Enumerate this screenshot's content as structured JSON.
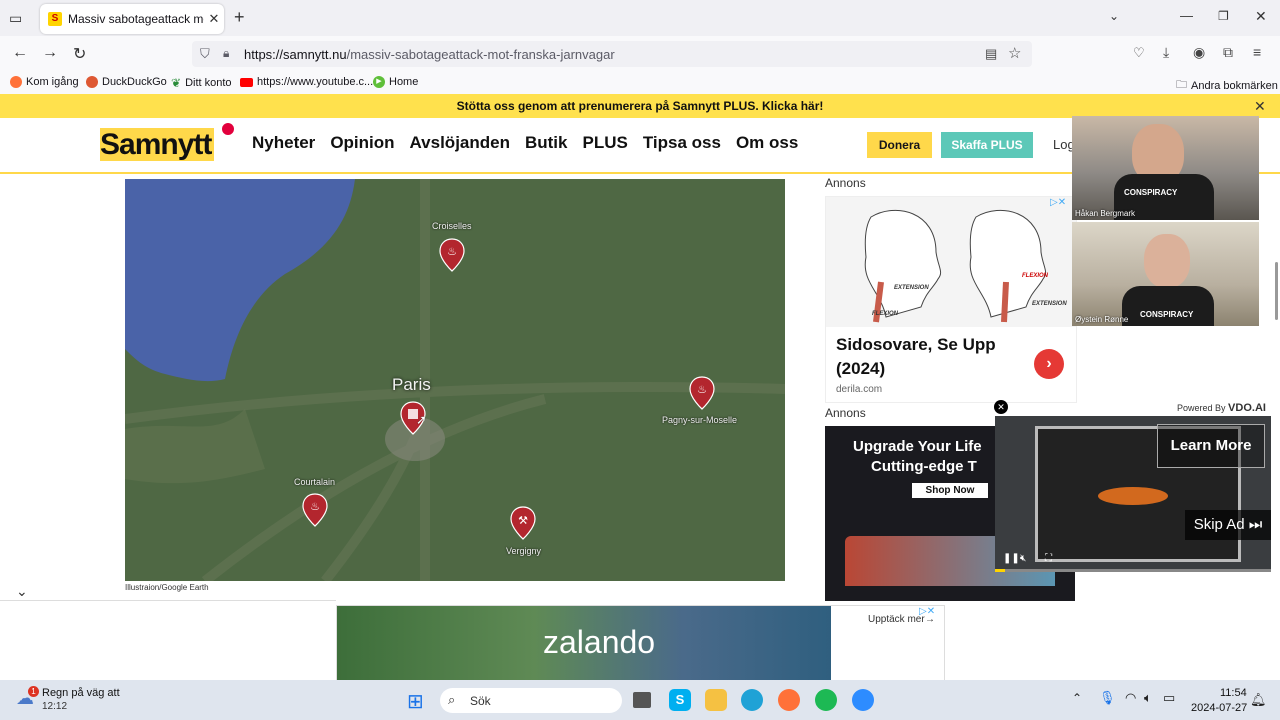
{
  "browser": {
    "tab_title": "Massiv sabotageattack mot fra",
    "url": "https://samnytt.nu/massiv-sabotageattack-mot-franska-jarnvagar",
    "url_host": "https://samnytt.nu",
    "url_path": "/massiv-sabotageattack-mot-franska-jarnvagar",
    "bookmarks": [
      {
        "label": "Kom igång",
        "icon": "firefox-icon"
      },
      {
        "label": "DuckDuckGo",
        "icon": "duckduckgo-icon"
      },
      {
        "label": "Ditt konto",
        "icon": "leaf-icon"
      },
      {
        "label": "https://www.youtube.c...",
        "icon": "youtube-icon"
      },
      {
        "label": "Home",
        "icon": "play-icon"
      }
    ],
    "other_bookmarks": "Andra bokmärken"
  },
  "site": {
    "promo": "Stötta oss genom att prenumerera på Samnytt PLUS. Klicka här!",
    "logo": "Samnytt",
    "nav": [
      "Nyheter",
      "Opinion",
      "Avslöjanden",
      "Butik",
      "PLUS",
      "Tipsa oss",
      "Om oss"
    ],
    "donate_label": "Donera",
    "plus_label": "Skaffa PLUS",
    "login_label": "Log"
  },
  "map": {
    "labels": {
      "paris": "Paris",
      "croiselles": "Croiselles",
      "pagny": "Pagny-sur-Moselle",
      "courtalain": "Courtalain",
      "vergigny": "Vergigny"
    },
    "credit": "Illustraion/Google Earth",
    "colors": {
      "land": "#4f6844",
      "sea": "#4a63a8",
      "pin": "#b3262e"
    }
  },
  "ads": {
    "annons1": "Annons",
    "annons2": "Annons",
    "ad1_labels": [
      "EXTENSION",
      "FLEXION",
      "FLEXION",
      "EXTENSION"
    ],
    "ad1_headline": "Sidosovare, Se Upp (2024)",
    "ad1_source": "derila.com",
    "ad2_line1": "Upgrade Your Life",
    "ad2_line2": "Cutting-edge T",
    "ad2_cta": "Shop Now",
    "vdo_powered": "Powered By",
    "vdo_brand": "VDO.AI",
    "vdo_learn": "Learn More",
    "vdo_skip": "Skip Ad",
    "bottom_brand": "zalando",
    "bottom_cta": "Upptäck mer"
  },
  "cams": {
    "top_name": "Håkan Bergmark",
    "bottom_name": "Øystein Rønne",
    "shirt_text": "CONSPIRACY"
  },
  "taskbar": {
    "weather": "Regn på väg att",
    "weather_badge": "1",
    "weather_time": "12:12",
    "search": "Sök",
    "time": "11:54",
    "date": "2024-07-27"
  }
}
